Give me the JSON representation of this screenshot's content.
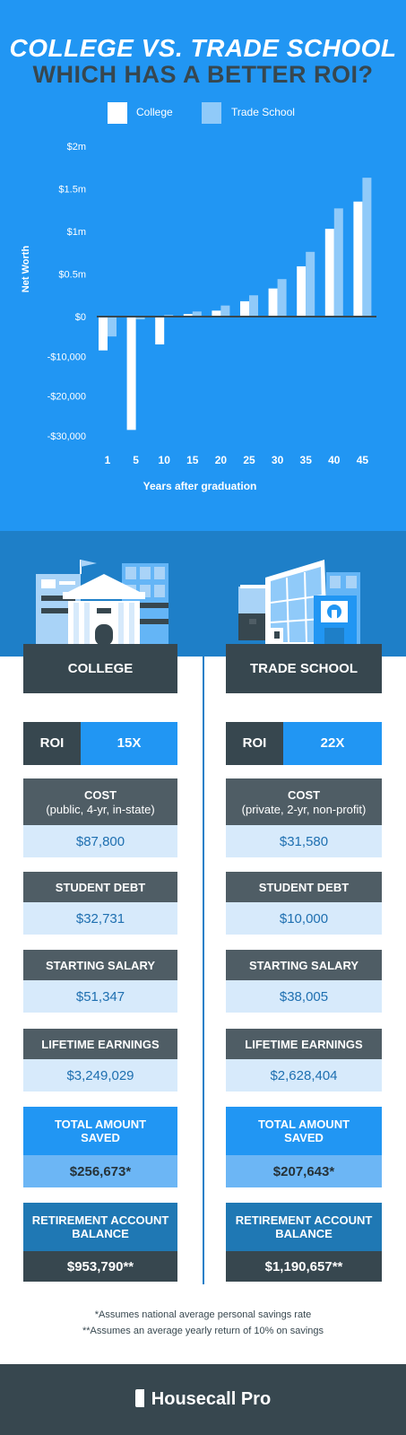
{
  "header": {
    "title_line1": "COLLEGE VS. TRADE SCHOOL",
    "title_line2": "WHICH HAS A BETTER ROI?"
  },
  "legend": {
    "college": "College",
    "trade_school": "Trade School"
  },
  "colors": {
    "background": "#2196f3",
    "college_bar": "#ffffff",
    "trade_bar": "#90caf9",
    "dark": "#37474f",
    "value_bg": "#d7eafb"
  },
  "chart_data": {
    "type": "bar",
    "title": "",
    "xlabel": "Years after graduation",
    "ylabel": "Net Worth",
    "categories": [
      "1",
      "5",
      "10",
      "15",
      "20",
      "25",
      "30",
      "35",
      "40",
      "45"
    ],
    "y_ticks_positive": [
      "$2m",
      "$1.5m",
      "$1m",
      "$0.5m",
      "$0"
    ],
    "y_ticks_negative": [
      "-$10,000",
      "-$20,000",
      "-$30,000"
    ],
    "positive_scale_max": 2000000,
    "negative_scale_min": -30000,
    "series": [
      {
        "name": "College",
        "values": [
          -8500,
          -28500,
          -7000,
          30000,
          70000,
          180000,
          330000,
          590000,
          1030000,
          1350000
        ]
      },
      {
        "name": "Trade School",
        "values": [
          -5000,
          -700,
          20000,
          60000,
          130000,
          250000,
          440000,
          760000,
          1270000,
          1630000
        ]
      }
    ],
    "legend_position": "top",
    "grid": false
  },
  "college": {
    "heading": "COLLEGE",
    "roi_label": "ROI",
    "roi_value": "15X",
    "cost_label": "COST",
    "cost_sub": "(public, 4-yr, in-state)",
    "cost_value": "$87,800",
    "debt_label": "STUDENT DEBT",
    "debt_value": "$32,731",
    "salary_label": "STARTING SALARY",
    "salary_value": "$51,347",
    "lifetime_label": "LIFETIME EARNINGS",
    "lifetime_value": "$3,249,029",
    "saved_label": "TOTAL AMOUNT SAVED",
    "saved_value": "$256,673*",
    "retirement_label": "RETIREMENT ACCOUNT BALANCE",
    "retirement_value": "$953,790**"
  },
  "trade": {
    "heading": "TRADE SCHOOL",
    "roi_label": "ROI",
    "roi_value": "22X",
    "cost_label": "COST",
    "cost_sub": "(private, 2-yr, non-profit)",
    "cost_value": "$31,580",
    "debt_label": "STUDENT DEBT",
    "debt_value": "$10,000",
    "salary_label": "STARTING SALARY",
    "salary_value": "$38,005",
    "lifetime_label": "LIFETIME EARNINGS",
    "lifetime_value": "$2,628,404",
    "saved_label": "TOTAL AMOUNT SAVED",
    "saved_value": "$207,643*",
    "retirement_label": "RETIREMENT ACCOUNT BALANCE",
    "retirement_value": "$1,190,657**"
  },
  "notes": {
    "note1": "*Assumes national average personal savings rate",
    "note2": "**Assumes an average yearly return of 10% on savings"
  },
  "footer": {
    "brand": "Housecall Pro",
    "brand_icon": "housecall-logo-icon"
  }
}
